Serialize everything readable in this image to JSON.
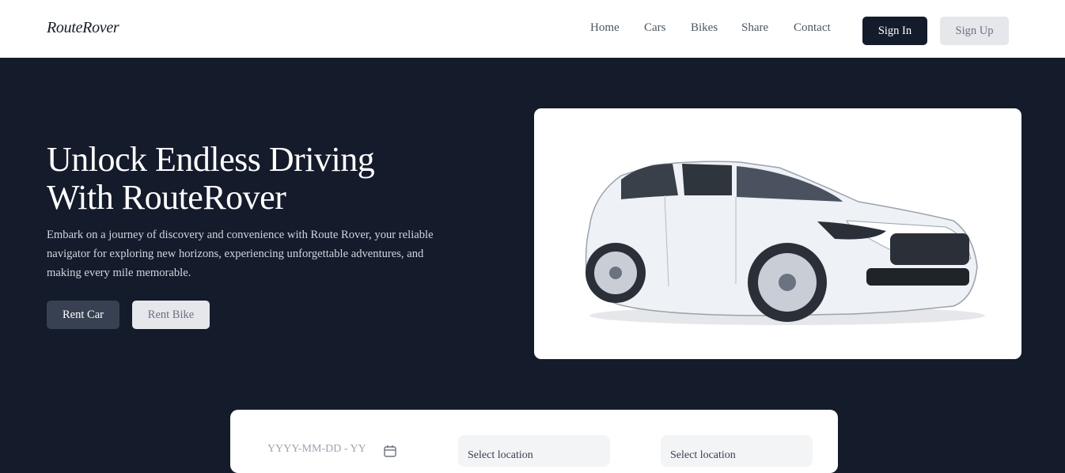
{
  "nav": {
    "brand": "RouteRover",
    "links": [
      "Home",
      "Cars",
      "Bikes",
      "Share",
      "Contact"
    ],
    "sign_in": "Sign In",
    "sign_up": "Sign Up"
  },
  "hero": {
    "title_line1": "Unlock Endless Driving",
    "title_line2": "With RouteRover",
    "subtitle_line1": "Embark on a journey of discovery and convenience with Route Rover, your reliable",
    "subtitle_line2": "navigator for exploring new horizons, experiencing unforgettable adventures, and",
    "subtitle_line3": "making every mile memorable.",
    "rent_car": "Rent Car",
    "rent_bike": "Rent Bike",
    "image": "white-hatchback-car-image"
  },
  "search": {
    "date_placeholder": "YYYY-MM-DD - YY",
    "select_1": "Select location",
    "select_2": "Select location"
  },
  "colors": {
    "dark": "#141b2b",
    "button_gray": "#374151",
    "light_button": "#e5e7eb"
  }
}
